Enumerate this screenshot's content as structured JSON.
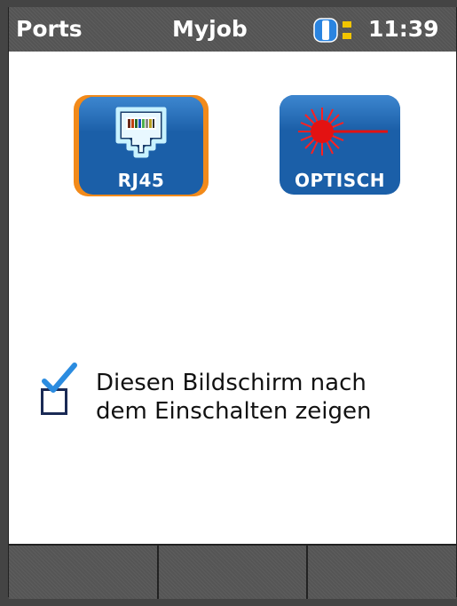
{
  "statusbar": {
    "left_label": "Ports",
    "center_label": "Myjob",
    "time": "11:39",
    "battery_icon": "battery-icon"
  },
  "ports": [
    {
      "label": "RJ45",
      "icon": "rj45-jack-icon",
      "selected": true
    },
    {
      "label": "OPTISCH",
      "icon": "laser-icon",
      "selected": false
    }
  ],
  "startup_option": {
    "checked": true,
    "label_line1": "Diesen Bildschirm nach",
    "label_line2": "dem Einschalten zeigen"
  },
  "softkeys": [
    {
      "label": ""
    },
    {
      "label": ""
    },
    {
      "label": ""
    }
  ],
  "colors": {
    "accent_blue": "#1b5fa8",
    "selection_orange": "#f28a1a",
    "laser_red": "#e31212"
  }
}
